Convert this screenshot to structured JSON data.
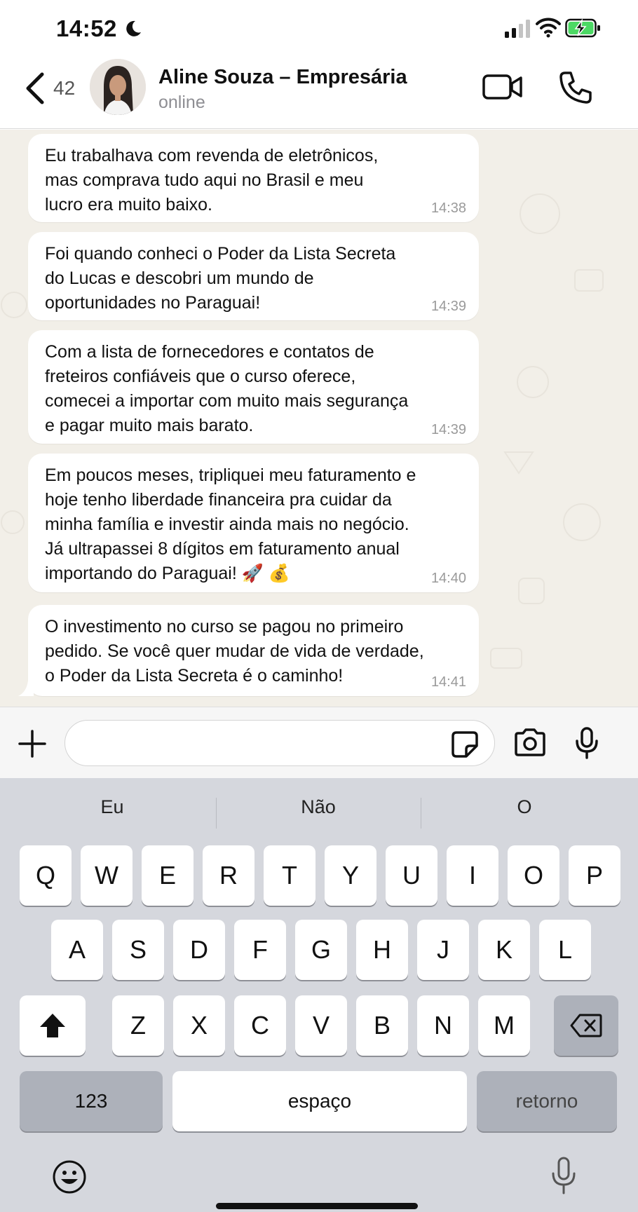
{
  "status_bar": {
    "time": "14:52",
    "icons": [
      "moon-icon",
      "signal-icon",
      "wifi-icon",
      "battery-charging-icon"
    ]
  },
  "header": {
    "back_icon": "chevron-left-icon",
    "unread_count": "42",
    "contact_name": "Aline Souza – Empresária",
    "contact_status": "online",
    "actions": [
      "video-call-icon",
      "phone-icon"
    ]
  },
  "messages": [
    {
      "text": "Eu trabalhava com revenda de eletrônicos,\nmas comprava tudo aqui no Brasil e meu\nlucro era muito baixo.",
      "time": "14:38"
    },
    {
      "text": "Foi quando conheci o Poder da Lista Secreta\ndo Lucas e descobri um mundo de\noportunidades no Paraguai!",
      "time": "14:39"
    },
    {
      "text": "Com a lista de fornecedores e contatos de\nfreteiros confiáveis que o curso oferece,\ncomecei a importar com muito mais segurança\ne pagar muito mais barato.",
      "time": "14:39"
    },
    {
      "text": "Em poucos meses, tripliquei meu faturamento e\nhoje tenho liberdade financeira pra cuidar da\nminha família e investir ainda mais no negócio.\nJá ultrapassei 8 dígitos em faturamento anual\nimportando do Paraguai! 🚀 💰",
      "time": "14:40"
    },
    {
      "text": "O investimento no curso se pagou no primeiro\npedido. Se você quer mudar de vida de verdade,\no Poder da Lista Secreta é o caminho!",
      "time": "14:41"
    }
  ],
  "composer": {
    "placeholder": "",
    "icons": [
      "plus-icon",
      "sticker-icon",
      "camera-icon",
      "microphone-icon"
    ]
  },
  "keyboard": {
    "suggestions": [
      "Eu",
      "Não",
      "O"
    ],
    "row1": [
      "Q",
      "W",
      "E",
      "R",
      "T",
      "Y",
      "U",
      "I",
      "O",
      "P"
    ],
    "row2": [
      "A",
      "S",
      "D",
      "F",
      "G",
      "H",
      "J",
      "K",
      "L"
    ],
    "row3": [
      "Z",
      "X",
      "C",
      "V",
      "B",
      "N",
      "M"
    ],
    "numbers_key": "123",
    "space_key": "espaço",
    "return_key": "retorno"
  }
}
